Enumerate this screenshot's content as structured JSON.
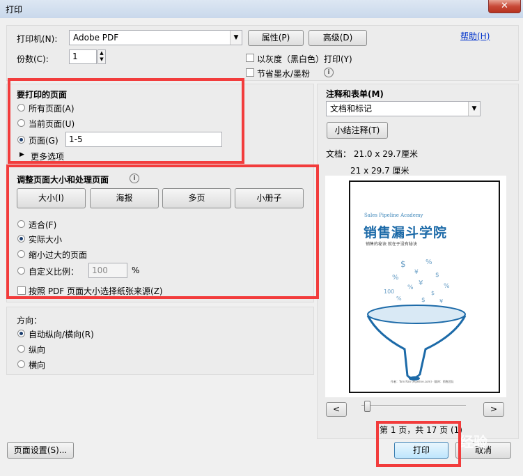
{
  "window": {
    "title": "打印",
    "close": "✕"
  },
  "printer": {
    "label": "打印机(N):",
    "selected": "Adobe PDF",
    "properties_button": "属性(P)",
    "advanced_button": "高级(D)",
    "help_link": "帮助(H)",
    "copies_label": "份数(C):",
    "copies_value": "1",
    "grayscale_label": "以灰度（黑白色）打印(Y)",
    "save_ink_label": "节省墨水/墨粉"
  },
  "pages_to_print": {
    "title": "要打印的页面",
    "all": "所有页面(A)",
    "current": "当前页面(U)",
    "pages": "页面(G)",
    "pages_value": "1-5",
    "more_options": "更多选项"
  },
  "sizing": {
    "title": "调整页面大小和处理页面",
    "tabs": [
      "大小(I)",
      "海报",
      "多页",
      "小册子"
    ],
    "fit": "适合(F)",
    "actual": "实际大小",
    "shrink": "缩小过大的页面",
    "custom": "自定义比例：",
    "custom_value": "100",
    "percent": "%",
    "paper_source": "按照 PDF 页面大小选择纸张来源(Z)"
  },
  "orientation": {
    "title": "方向：",
    "auto": "自动纵向/横向(R)",
    "portrait": "纵向",
    "landscape": "横向"
  },
  "comments": {
    "title": "注释和表单(M)",
    "selected": "文档和标记",
    "summarize_button": "小结注释(T)"
  },
  "preview": {
    "doc_size": "文档： 21.0 x 29.7厘米",
    "paper_size": "21 x 29.7 厘米",
    "page_status": "第 1 页，共 17 页 (1)",
    "cover": {
      "subtitle": "Sales Pipeline Academy",
      "title": "销售漏斗学院",
      "tagline": "销售的秘诀 就在于没有秘诀",
      "footer": "作者：Tom Ran (Pipeline.com) · 翻译：销售团队"
    }
  },
  "footer": {
    "page_setup": "页面设置(S)...",
    "print": "打印",
    "cancel": "取消",
    "watermark": "经验"
  },
  "colors": {
    "highlight": "#f23c3c",
    "accent": "#1c6aa8"
  }
}
